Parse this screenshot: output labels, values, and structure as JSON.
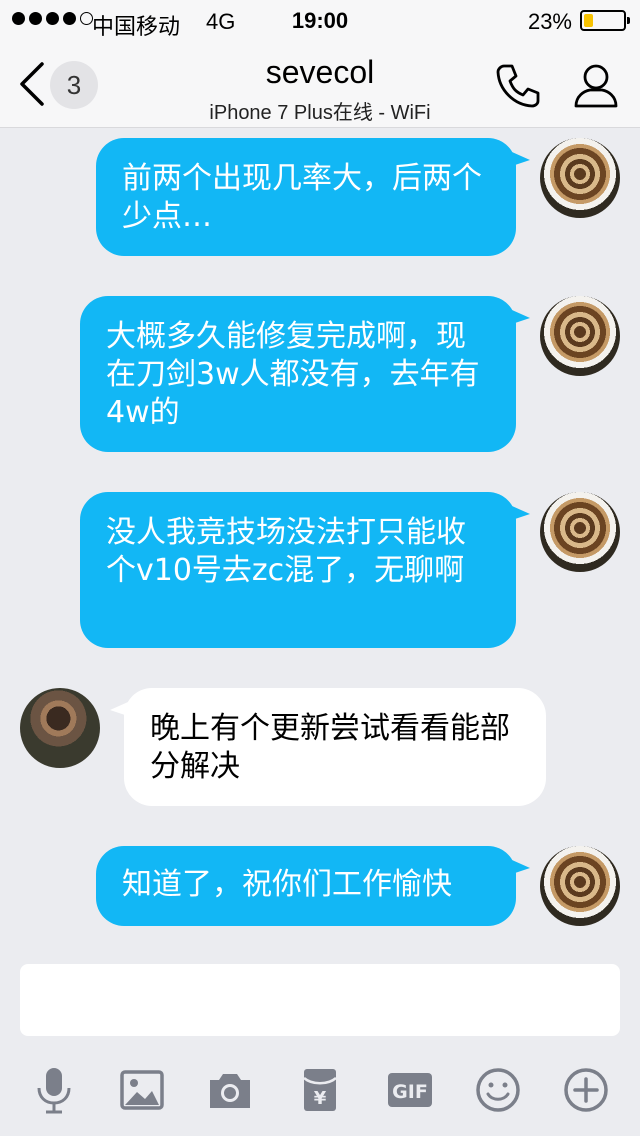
{
  "status_bar": {
    "carrier": "中国移动",
    "network": "4G",
    "time": "19:00",
    "battery_percent": "23%",
    "battery_level": 0.23,
    "battery_color": "#f7c200"
  },
  "nav": {
    "unread_count": "3",
    "title": "sevecol",
    "subtitle": "iPhone 7 Plus在线 - WiFi",
    "back_icon": "chevron-left-icon",
    "call_icon": "phone-icon",
    "profile_icon": "person-icon"
  },
  "messages": [
    {
      "direction": "outgoing",
      "text": "前两个出现几率大，后两个少点…"
    },
    {
      "direction": "outgoing",
      "text": "大概多久能修复完成啊，现在刀剑3w人都没有，去年有4w的"
    },
    {
      "direction": "outgoing",
      "text": "没人我竞技场没法打只能收个v10号去zc混了，无聊啊"
    },
    {
      "direction": "incoming",
      "text": "晚上有个更新尝试看看能部分解决"
    },
    {
      "direction": "outgoing",
      "text": "知道了，祝你们工作愉快"
    }
  ],
  "input": {
    "value": "",
    "placeholder": ""
  },
  "toolbar": {
    "items": [
      "microphone-icon",
      "image-icon",
      "camera-icon",
      "red-packet-icon",
      "gif-icon",
      "emoji-icon",
      "plus-icon"
    ],
    "gif_label": "GIF",
    "red_packet_symbol": "¥"
  },
  "colors": {
    "outgoing_bubble": "#12b7f5",
    "incoming_bubble": "#ffffff",
    "background": "#ebecf0",
    "icon_gray": "#7b7f8a"
  }
}
